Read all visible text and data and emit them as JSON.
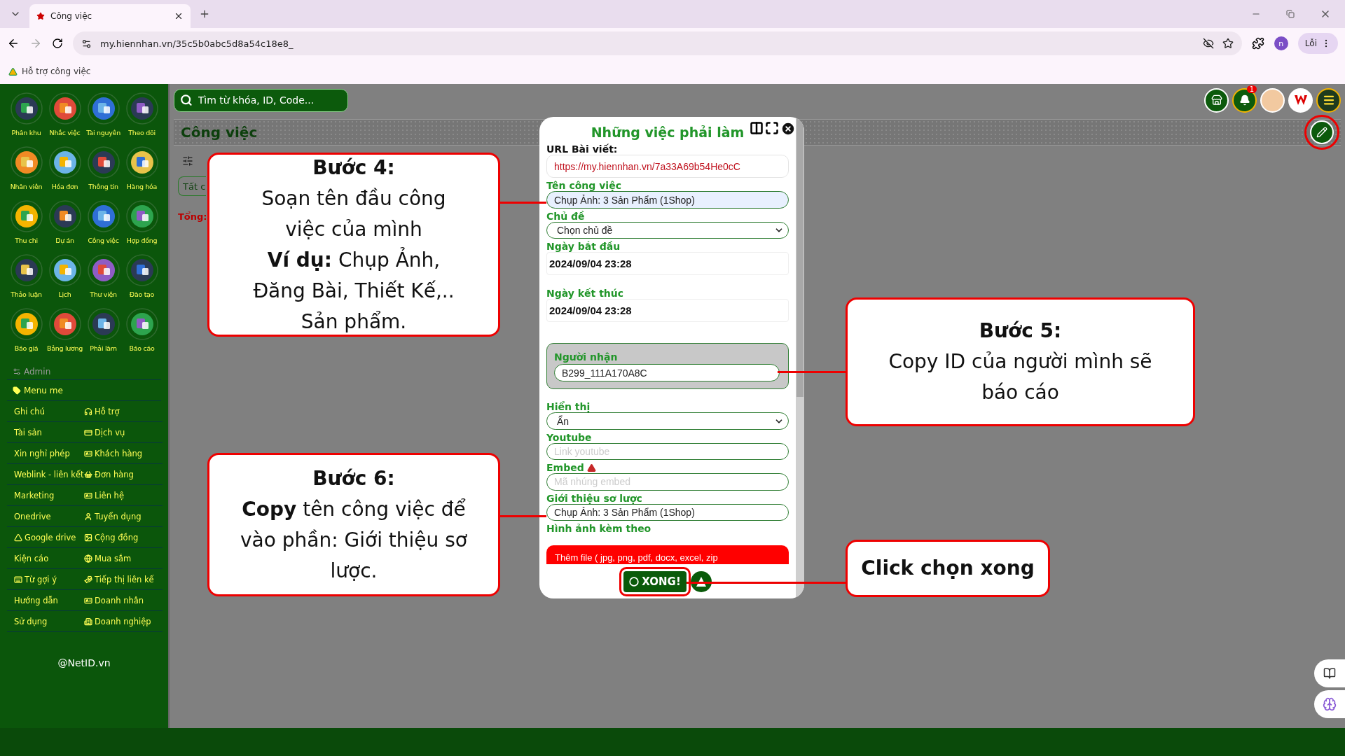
{
  "browser": {
    "tabs": [
      {
        "title": "Công việc",
        "selected": true
      }
    ],
    "url": "my.hiennhan.vn/35c5b0abc5d8a54c18e8_",
    "profile": "n",
    "error_label": "Lỗi",
    "bookmarks": [
      {
        "label": "Hỗ trợ công việc"
      }
    ]
  },
  "sidebar": {
    "apps": [
      "Phân khu",
      "Nhắc việc",
      "Tài nguyên",
      "Theo dõi",
      "Nhân viên",
      "Hóa đơn",
      "Thông tin",
      "Hàng hóa",
      "Thu chi",
      "Dự án",
      "Công việc",
      "Hợp đồng",
      "Thảo luận",
      "Lịch",
      "Thư viện",
      "Đào tạo",
      "Báo giá",
      "Bảng lương",
      "Phải làm",
      "Báo cáo"
    ],
    "admin": "Admin",
    "menu_title": "Menu me",
    "links": [
      {
        "label": "Ghi chú",
        "has_icon": false
      },
      {
        "label": "Hỗ trợ",
        "has_icon": true
      },
      {
        "label": "Tài sản",
        "has_icon": false
      },
      {
        "label": "Dịch vụ",
        "has_icon": true
      },
      {
        "label": "Xin nghỉ phép",
        "has_icon": false
      },
      {
        "label": "Khách hàng",
        "has_icon": true
      },
      {
        "label": "Weblink - liên kết",
        "has_icon": false
      },
      {
        "label": "Đơn hàng",
        "has_icon": true
      },
      {
        "label": "Marketing",
        "has_icon": false
      },
      {
        "label": "Liên hệ",
        "has_icon": true
      },
      {
        "label": "Onedrive",
        "has_icon": false
      },
      {
        "label": "Tuyển dụng",
        "has_icon": true
      },
      {
        "label": "Google drive",
        "has_icon": true
      },
      {
        "label": "Cộng đồng",
        "has_icon": true
      },
      {
        "label": "Kiện cáo",
        "has_icon": false
      },
      {
        "label": "Mua sắm",
        "has_icon": true
      },
      {
        "label": "Từ gợi ý",
        "has_icon": true
      },
      {
        "label": "Tiếp thị liên kế",
        "has_icon": true
      },
      {
        "label": "Hướng dẫn",
        "has_icon": false
      },
      {
        "label": "Doanh nhân",
        "has_icon": true
      },
      {
        "label": "Sử dụng",
        "has_icon": false
      },
      {
        "label": "Doanh nghiệp",
        "has_icon": true
      }
    ],
    "footer": "@NetID.vn"
  },
  "topbar": {
    "search_placeholder": "Tìm từ khóa, ID, Code...",
    "notification_count": "1"
  },
  "page": {
    "title": "Công việc",
    "filter": "Tất c",
    "total": "Tổng:"
  },
  "dialog": {
    "title": "Những việc phải làm",
    "fields": [
      {
        "kind": "url",
        "label": "URL Bài viết:",
        "value": "https://my.hiennhan.vn/7a33A69b54He0cC"
      },
      {
        "kind": "text",
        "label": "Tên công việc",
        "value": "Chụp Ảnh: 3 Sản Phẩm (1Shop)",
        "highlighted": true
      },
      {
        "kind": "select",
        "label": "Chủ đề",
        "value": "Chọn chủ đề"
      },
      {
        "kind": "date",
        "label": "Ngày bắt đầu",
        "value": "2024/09/04 23:28"
      },
      {
        "kind": "date",
        "label": "Ngày kết thúc",
        "value": "2024/09/04 23:28"
      },
      {
        "kind": "recipient",
        "label": "Người nhận",
        "value": "B299_111A170A8C"
      },
      {
        "kind": "select",
        "label": "Hiển thị",
        "value": "Ẩn"
      },
      {
        "kind": "text",
        "label": "Youtube",
        "placeholder": "Link youtube",
        "highlighted": false
      },
      {
        "kind": "text",
        "label": "Embed",
        "placeholder": "Mã nhúng embed",
        "highlighted": false,
        "label_icon": true
      },
      {
        "kind": "text",
        "label": "Giới thiệu sơ lược",
        "value": "Chụp Ảnh: 3 Sản Phẩm (1Shop)",
        "highlighted": false
      },
      {
        "kind": "upload",
        "label": "Hình ảnh kèm theo",
        "button": "Thêm file ( jpg, png, pdf, docx, excel, zip"
      }
    ],
    "submit": "XONG!"
  },
  "callouts": [
    {
      "title": "Bước 4:",
      "body": [
        "Soạn tên đầu công việc của mình",
        "**Ví dụ:** Chụp Ảnh, Đăng Bài, Thiết Kế,.. Sản phẩm."
      ]
    },
    {
      "title": "Bước 5:",
      "body": [
        "Copy ID của người mình sẽ báo cáo"
      ]
    },
    {
      "title": "Bước 6:",
      "body": [
        "**Copy** tên công việc để vào phần: Giới thiệu sơ lược."
      ]
    },
    {
      "title": "Click chọn xong"
    }
  ]
}
